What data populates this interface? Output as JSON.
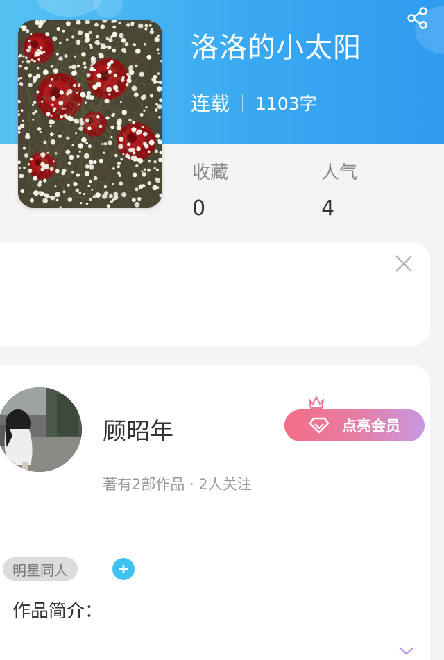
{
  "book": {
    "title": "洛洛的小太阳",
    "status": "连载",
    "word_count": "1103字"
  },
  "stats": [
    {
      "label": "收藏",
      "value": "0"
    },
    {
      "label": "人气",
      "value": "4"
    }
  ],
  "author": {
    "name": "顾昭年",
    "summary": "著有2部作品 · 2人关注",
    "vip_button_label": "点亮会员"
  },
  "tags": [
    "明星同人"
  ],
  "intro": {
    "label": "作品简介："
  },
  "colors": {
    "header_gradient_start": "#55c3f2",
    "header_gradient_end": "#2f9bf0",
    "vip_gradient_start": "#f36d87",
    "vip_gradient_end": "#c898e0",
    "add_button": "#3fc3ee",
    "crown": "#f07a92"
  },
  "icons": {
    "share": "share-icon",
    "close": "close-icon",
    "crown": "crown-icon",
    "gem": "diamond-icon",
    "add": "plus-icon",
    "expand": "chevron-down-icon"
  }
}
